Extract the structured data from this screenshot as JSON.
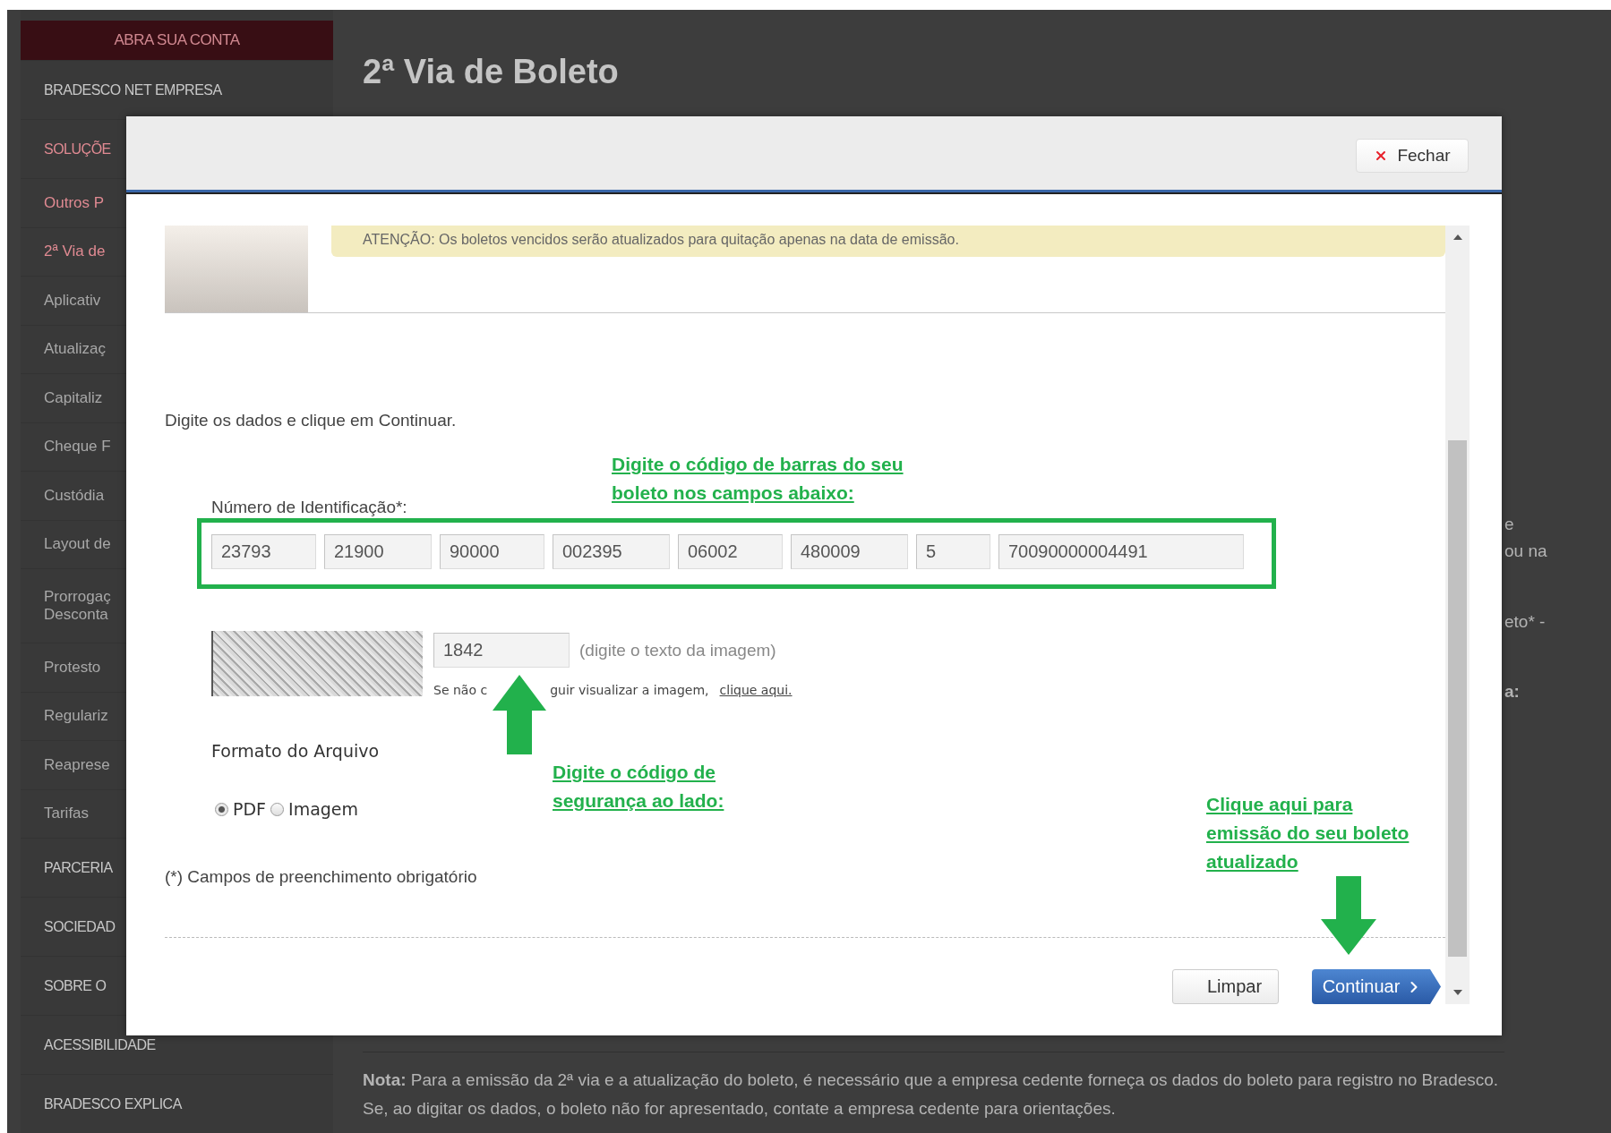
{
  "sidebar": {
    "cta": "ABRA SUA CONTA",
    "items": [
      {
        "label": "BRADESCO NET EMPRESA",
        "kind": "group",
        "active": false
      },
      {
        "label": "SOLUÇÕE",
        "kind": "group",
        "active": true
      },
      {
        "label": "Outros P",
        "kind": "sub",
        "active": true
      },
      {
        "label": "2ª Via de",
        "kind": "sub",
        "active": true
      },
      {
        "label": "Aplicativ",
        "kind": "sub",
        "active": false
      },
      {
        "label": "Atualizaç",
        "kind": "sub",
        "active": false
      },
      {
        "label": "Capitaliz",
        "kind": "sub",
        "active": false
      },
      {
        "label": "Cheque F",
        "kind": "sub",
        "active": false
      },
      {
        "label": "Custódia",
        "kind": "sub",
        "active": false
      },
      {
        "label": "Layout de",
        "kind": "sub",
        "active": false
      },
      {
        "label": "Prorrogaç\nDesconta",
        "kind": "sub",
        "active": false
      },
      {
        "label": "Protesto",
        "kind": "sub",
        "active": false
      },
      {
        "label": "Regulariz",
        "kind": "sub",
        "active": false
      },
      {
        "label": "Reapresе",
        "kind": "sub",
        "active": false
      },
      {
        "label": "Tarifas",
        "kind": "sub",
        "active": false
      },
      {
        "label": "PARCERIA",
        "kind": "group",
        "active": false
      },
      {
        "label": "SOCIEDAD",
        "kind": "group",
        "active": false
      },
      {
        "label": "SOBRE O",
        "kind": "group",
        "active": false
      },
      {
        "label": "ACESSIBILIDADE",
        "kind": "group",
        "active": false
      },
      {
        "label": "BRADESCO EXPLICA",
        "kind": "group",
        "active": false
      }
    ]
  },
  "page": {
    "title": "2ª Via de Boleto",
    "side_fragments": [
      {
        "text": "e",
        "bold": false
      },
      {
        "text": "ou na",
        "bold": false
      },
      {
        "text": "eto* -",
        "bold": false
      },
      {
        "text": "a:",
        "bold": true
      }
    ],
    "note": "**Nota:** Para a emissão da 2ª via e a atualização do boleto, é necessário que a empresa cedente forneça os dados do boleto para registro no Bradesco. Se, ao digitar os dados, o boleto não for apresentado, contate a empresa cedente para orientações."
  },
  "modal": {
    "close_button": "Fechar",
    "notice": "ATENÇÃO: Os boletos vencidos serão atualizados para quitação apenas na data de emissão.",
    "intro": "Digite os dados e clique em Continuar.",
    "id_label": "Número de Identificação*:",
    "id_fields": [
      "23793",
      "21900",
      "90000",
      "002395",
      "06002",
      "480009",
      "5",
      "70090000004491"
    ],
    "captcha": {
      "value": "1842",
      "hint": "(digite o texto da imagem)",
      "help_before": "Se não c",
      "help_after": "guir visualizar a imagem,",
      "link": "clique aqui."
    },
    "format": {
      "label": "Formato do Arquivo",
      "options": [
        {
          "label": "PDF",
          "selected": true
        },
        {
          "label": "Imagem",
          "selected": false
        }
      ]
    },
    "required_note": "(*) Campos de preenchimento obrigatório",
    "buttons": [
      {
        "label": "Limpar",
        "kind": "secondary"
      },
      {
        "label": "Continuar",
        "kind": "primary"
      }
    ]
  },
  "annotations": [
    {
      "text": "Digite o código de barras do seu\nboleto nos campos abaixo:"
    },
    {
      "text": "Digite o código de\nsegurança ao lado:"
    },
    {
      "text": "Clique aqui para\nemissão do seu boleto\natualizado"
    }
  ]
}
